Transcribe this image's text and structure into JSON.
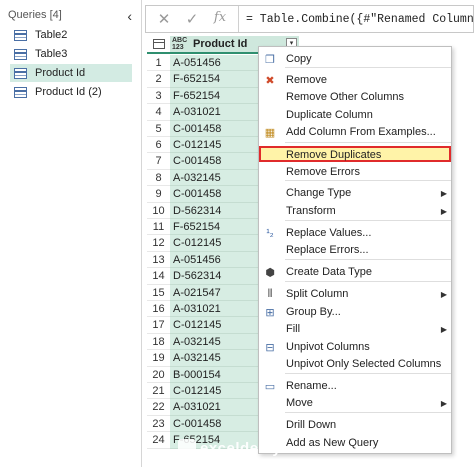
{
  "queries": {
    "header": "Queries [4]",
    "collapse_icon": "‹",
    "items": [
      {
        "label": "Table2",
        "icon": "table-icon"
      },
      {
        "label": "Table3",
        "icon": "table-icon"
      },
      {
        "label": "Product Id",
        "icon": "table-icon",
        "selected": true
      },
      {
        "label": "Product Id (2)",
        "icon": "table-icon"
      }
    ]
  },
  "formula_bar": {
    "cancel_glyph": "✕",
    "confirm_glyph": "✓",
    "fx_glyph": "fx",
    "formula": "= Table.Combine({#\"Renamed Columns\", #\"Pro"
  },
  "grid": {
    "type_badge": "ABC\n123",
    "column_header": "Product Id",
    "dropdown_glyph": "▾",
    "rows": [
      {
        "n": "1",
        "value": "A-051456"
      },
      {
        "n": "2",
        "value": "F-652154"
      },
      {
        "n": "3",
        "value": "F-652154"
      },
      {
        "n": "4",
        "value": "A-031021"
      },
      {
        "n": "5",
        "value": "C-001458"
      },
      {
        "n": "6",
        "value": "C-012145"
      },
      {
        "n": "7",
        "value": "C-001458"
      },
      {
        "n": "8",
        "value": "A-032145"
      },
      {
        "n": "9",
        "value": "C-001458"
      },
      {
        "n": "10",
        "value": "D-562314"
      },
      {
        "n": "11",
        "value": "F-652154"
      },
      {
        "n": "12",
        "value": "C-012145"
      },
      {
        "n": "13",
        "value": "A-051456"
      },
      {
        "n": "14",
        "value": "D-562314"
      },
      {
        "n": "15",
        "value": "A-021547"
      },
      {
        "n": "16",
        "value": "A-031021"
      },
      {
        "n": "17",
        "value": "C-012145"
      },
      {
        "n": "18",
        "value": "A-032145"
      },
      {
        "n": "19",
        "value": "A-032145"
      },
      {
        "n": "20",
        "value": "B-000154"
      },
      {
        "n": "21",
        "value": "C-012145"
      },
      {
        "n": "22",
        "value": "A-031021"
      },
      {
        "n": "23",
        "value": "C-001458"
      },
      {
        "n": "24",
        "value": "F-652154"
      }
    ]
  },
  "context_menu": {
    "items": [
      {
        "label": "Copy",
        "icon": "copy-icon",
        "glyph": "❐"
      },
      {
        "label": "Remove",
        "icon": "remove-icon",
        "glyph": "✖"
      },
      {
        "label": "Remove Other Columns",
        "icon": "",
        "glyph": ""
      },
      {
        "label": "Duplicate Column",
        "icon": "",
        "glyph": ""
      },
      {
        "label": "Add Column From Examples...",
        "icon": "add-column-examples-icon",
        "glyph": "▦"
      },
      {
        "label": "Remove Duplicates",
        "icon": "",
        "glyph": "",
        "highlighted": true
      },
      {
        "label": "Remove Errors",
        "icon": "",
        "glyph": ""
      },
      {
        "label": "Change Type",
        "icon": "",
        "glyph": "",
        "submenu": true
      },
      {
        "label": "Transform",
        "icon": "",
        "glyph": "",
        "submenu": true
      },
      {
        "label": "Replace Values...",
        "icon": "replace-values-icon",
        "glyph": "¹₂"
      },
      {
        "label": "Replace Errors...",
        "icon": "",
        "glyph": ""
      },
      {
        "label": "Create Data Type",
        "icon": "create-data-type-icon",
        "glyph": "⬢"
      },
      {
        "label": "Split Column",
        "icon": "split-column-icon",
        "glyph": "⫴",
        "submenu": true
      },
      {
        "label": "Group By...",
        "icon": "group-by-icon",
        "glyph": "⊞"
      },
      {
        "label": "Fill",
        "icon": "",
        "glyph": "",
        "submenu": true
      },
      {
        "label": "Unpivot Columns",
        "icon": "unpivot-icon",
        "glyph": "⊟"
      },
      {
        "label": "Unpivot Only Selected Columns",
        "icon": "",
        "glyph": ""
      },
      {
        "label": "Rename...",
        "icon": "rename-icon",
        "glyph": "▭"
      },
      {
        "label": "Move",
        "icon": "",
        "glyph": "",
        "submenu": true
      },
      {
        "label": "Drill Down",
        "icon": "",
        "glyph": ""
      },
      {
        "label": "Add as New Query",
        "icon": "",
        "glyph": ""
      }
    ],
    "submenu_glyph": "▶"
  },
  "watermark": {
    "text": "exceldemy",
    "subtext": "EXCEL · DATA · BI"
  },
  "colors": {
    "accent": "#2f8f6f",
    "selected_query": "#d3ebe3",
    "column_fill": "#d7ede3",
    "highlight_border": "#e02b2b",
    "highlight_fill": "#fff3a8"
  }
}
